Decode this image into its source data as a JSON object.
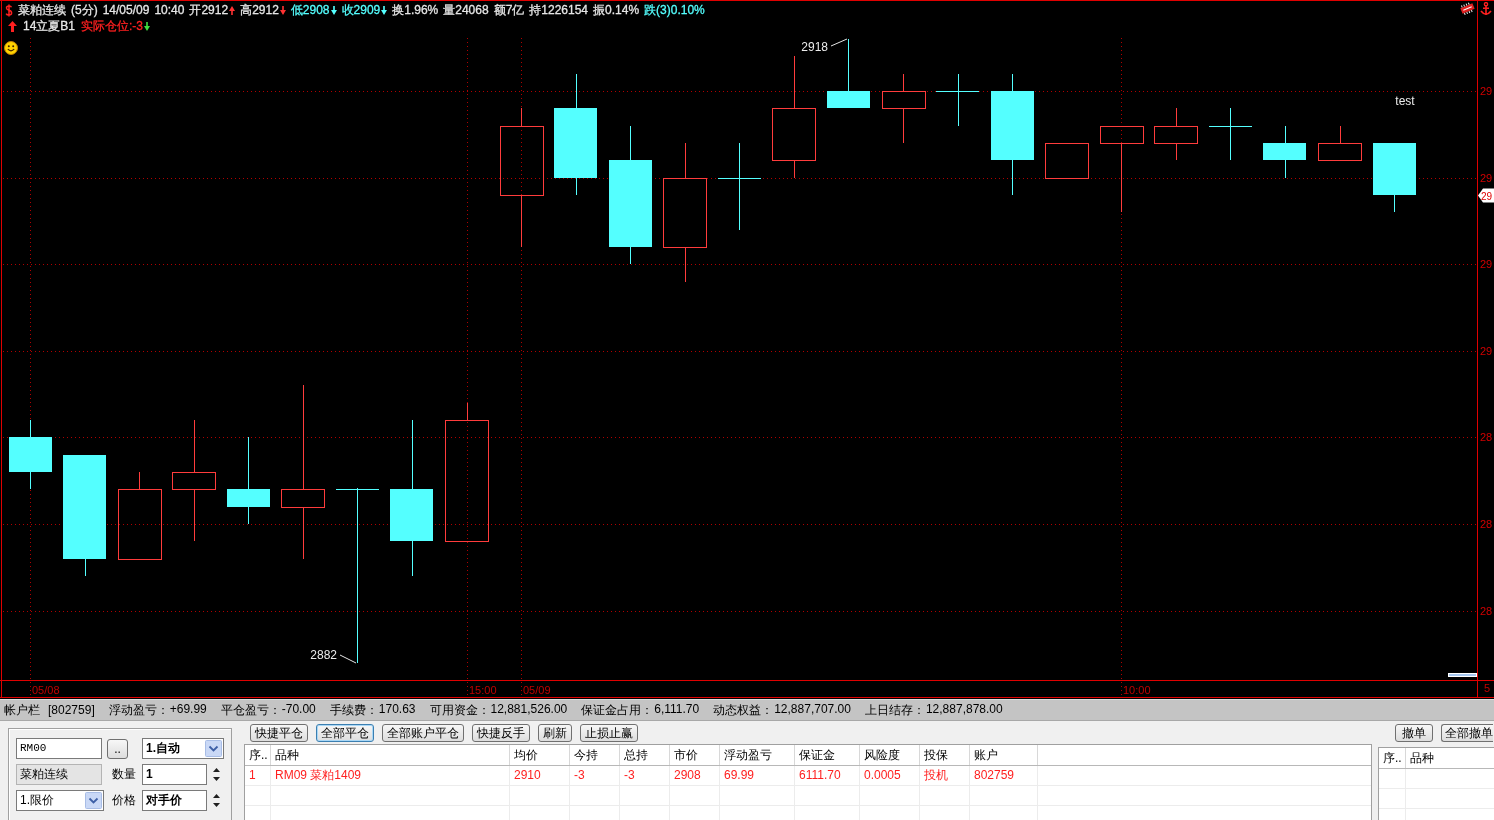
{
  "chart": {
    "header": {
      "quote": [
        {
          "kind": "text",
          "text": "菜粕连续",
          "color": "#e6e6e6"
        },
        {
          "kind": "text",
          "text": "(5分)",
          "color": "#e6e6e6"
        },
        {
          "kind": "text",
          "text": "14/05/09",
          "color": "#e6e6e6"
        },
        {
          "kind": "text",
          "text": "10:40",
          "color": "#e6e6e6"
        },
        {
          "kind": "text",
          "text": "开2912",
          "color": "#e6e6e6"
        },
        {
          "kind": "up_arrow",
          "color": "#ff3232"
        },
        {
          "kind": "text",
          "text": "高2912",
          "color": "#e6e6e6"
        },
        {
          "kind": "down_arrow",
          "color": "#ff3232"
        },
        {
          "kind": "text",
          "text": "低2908",
          "color": "#54ffff"
        },
        {
          "kind": "down_arrow",
          "color": "#54ffff"
        },
        {
          "kind": "text",
          "text": "收2909",
          "color": "#54ffff"
        },
        {
          "kind": "down_arrow",
          "color": "#54ffff"
        },
        {
          "kind": "text",
          "text": "换1.96%",
          "color": "#e6e6e6"
        },
        {
          "kind": "text",
          "text": "量24068",
          "color": "#e6e6e6"
        },
        {
          "kind": "text",
          "text": "额7亿",
          "color": "#e6e6e6"
        },
        {
          "kind": "text",
          "text": "持1226154",
          "color": "#e6e6e6"
        },
        {
          "kind": "text",
          "text": "振0.14%",
          "color": "#e6e6e6"
        },
        {
          "kind": "text",
          "text": "跌(3)0.10%",
          "color": "#54ffff"
        }
      ],
      "position": [
        {
          "kind": "text",
          "text": "14立夏B1",
          "color": "#e6e6e6"
        },
        {
          "kind": "text",
          "text": "实际仓位:-3",
          "color": "#ff2020"
        },
        {
          "kind": "down_arrow",
          "color": "#40e040"
        }
      ]
    },
    "callouts": [
      {
        "kind": "high",
        "text": "2918"
      },
      {
        "kind": "low",
        "text": "2882"
      }
    ],
    "note": "test",
    "current_price_label": "29",
    "y_axis_labels": [
      "29",
      "29",
      "29",
      "29",
      "28",
      "28",
      "28"
    ],
    "x_axis_labels": [
      "05/08",
      "15:00",
      "05/09",
      "10:00"
    ],
    "corner_label": "5"
  },
  "account_bar": {
    "title": "帐户栏",
    "account": "[802759]",
    "fields": [
      {
        "label": "浮动盈亏：",
        "value": "+69.99"
      },
      {
        "label": "平仓盈亏：",
        "value": "-70.00"
      },
      {
        "label": "手续费：",
        "value": "170.63"
      },
      {
        "label": "可用资金：",
        "value": "12,881,526.00"
      },
      {
        "label": "保证金占用：",
        "value": "6,111.70"
      },
      {
        "label": "动态权益：",
        "value": "12,887,707.00"
      },
      {
        "label": "上日结存：",
        "value": "12,887,878.00"
      }
    ]
  },
  "order_panel": {
    "symbol_field": {
      "value": "RM00"
    },
    "browse_button": "..",
    "open_close_select": {
      "value": "1.自动"
    },
    "name_field": {
      "value": "菜粕连续"
    },
    "quantity": {
      "label": "数量",
      "value": "1"
    },
    "order_type_select": {
      "value": "1.限价"
    },
    "price": {
      "label": "价格",
      "value": "对手价"
    }
  },
  "positions": {
    "buttons": [
      {
        "label": "快捷平仓",
        "focused": false
      },
      {
        "label": "全部平仓",
        "focused": true
      },
      {
        "label": "全部账户平仓",
        "focused": false
      },
      {
        "label": "快捷反手",
        "focused": false
      },
      {
        "label": "刷新",
        "focused": false
      },
      {
        "label": "止损止赢",
        "focused": false
      }
    ],
    "table": {
      "columns": [
        "序..",
        "品种",
        "均价",
        "今持",
        "总持",
        "市价",
        "浮动盈亏",
        "保证金",
        "风险度",
        "投保",
        "账户"
      ],
      "rows": [
        {
          "color": "#ff2020",
          "cells": [
            "1",
            "RM09 菜粕1409",
            "2910",
            "-3",
            "-3",
            "2908",
            "69.99",
            "6111.70",
            "0.0005",
            "投机",
            "802759"
          ]
        }
      ]
    }
  },
  "orders": {
    "buttons": [
      {
        "label": "撤单",
        "focused": false
      },
      {
        "label": "全部撤单",
        "focused": false
      }
    ],
    "table": {
      "columns": [
        "序..",
        "品种"
      ]
    }
  }
}
